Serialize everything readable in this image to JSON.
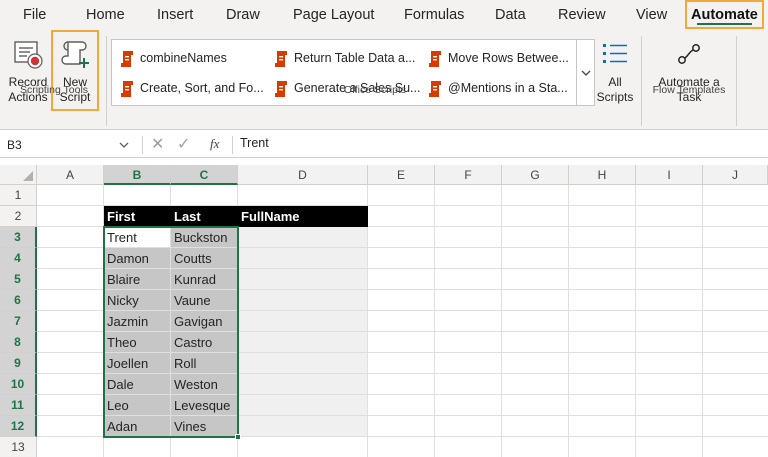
{
  "menu": {
    "tabs": [
      "File",
      "Home",
      "Insert",
      "Draw",
      "Page Layout",
      "Formulas",
      "Data",
      "Review",
      "View",
      "Automate"
    ],
    "active": "Automate"
  },
  "ribbon": {
    "scripting_tools": {
      "label": "Scripting Tools",
      "record_line1": "Record",
      "record_line2": "Actions",
      "new_line1": "New",
      "new_line2": "Script"
    },
    "office_scripts": {
      "label": "Office Scripts",
      "items": [
        "combineNames",
        "Return Table Data a...",
        "Move Rows Betwee...",
        "Create, Sort, and Fo...",
        "Generate a Sales Su...",
        "@Mentions in a Sta..."
      ],
      "all_line1": "All",
      "all_line2": "Scripts"
    },
    "flow_templates": {
      "label": "Flow Templates",
      "automate_line1": "Automate a",
      "automate_line2": "Task"
    }
  },
  "formula_bar": {
    "name_box": "B3",
    "fx": "fx",
    "value": "Trent"
  },
  "grid": {
    "columns": [
      "A",
      "B",
      "C",
      "D",
      "E",
      "F",
      "G",
      "H",
      "I",
      "J"
    ],
    "rows": [
      "1",
      "2",
      "3",
      "4",
      "5",
      "6",
      "7",
      "8",
      "9",
      "10",
      "11",
      "12",
      "13"
    ],
    "header_row": [
      "First",
      "Last",
      "FullName"
    ],
    "data": [
      [
        "Trent",
        "Buckston"
      ],
      [
        "Damon",
        "Coutts"
      ],
      [
        "Blaire",
        "Kunrad"
      ],
      [
        "Nicky",
        "Vaune"
      ],
      [
        "Jazmin",
        "Gavigan"
      ],
      [
        "Theo",
        "Castro"
      ],
      [
        "Joellen",
        "Roll"
      ],
      [
        "Dale",
        "Weston"
      ],
      [
        "Leo",
        "Levesque"
      ],
      [
        "Adan",
        "Vines"
      ]
    ]
  },
  "colors": {
    "accent": "#217346",
    "highlight": "#f2a93b",
    "script_icon": "#d83b01"
  },
  "icons": {
    "record": "record-actions-icon",
    "new_script": "new-script-icon",
    "script": "script-icon",
    "all_scripts": "list-icon",
    "flow": "flow-icon"
  }
}
